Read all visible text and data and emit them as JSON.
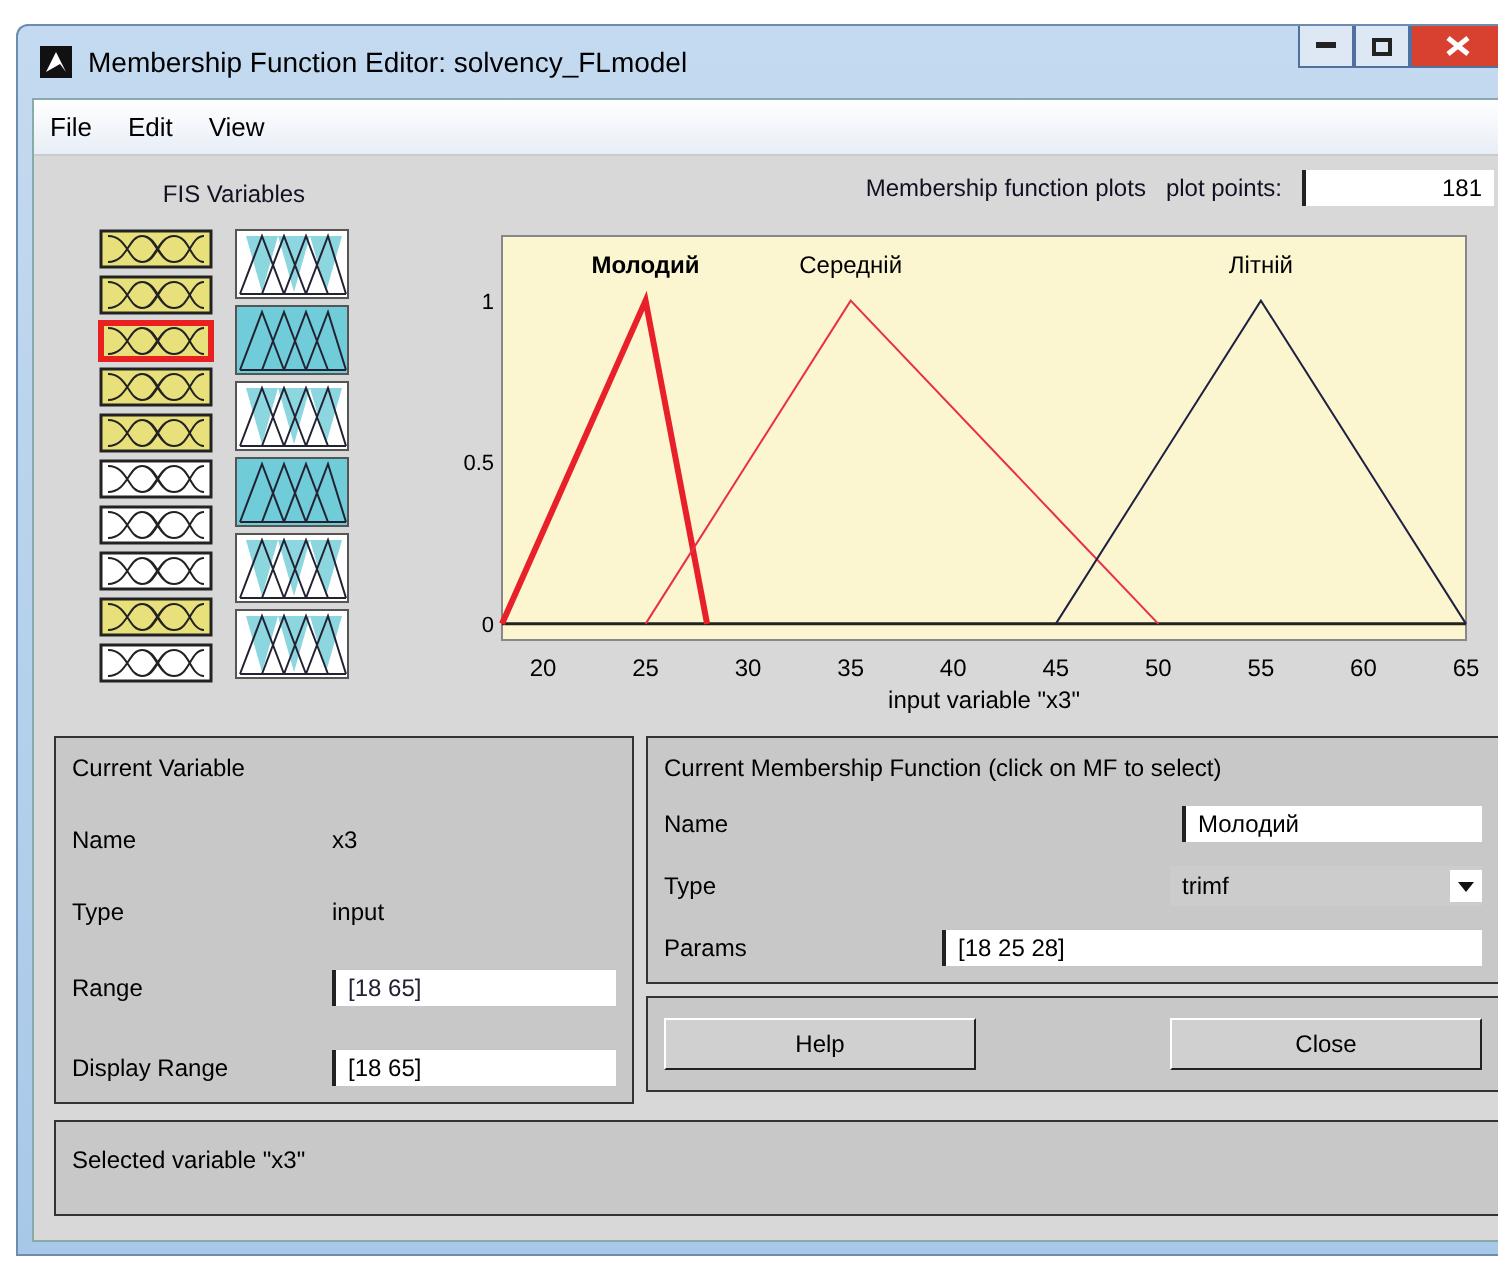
{
  "window": {
    "title": "Membership Function Editor: solvency_FLmodel"
  },
  "menu": [
    "File",
    "Edit",
    "View"
  ],
  "fis_variables": {
    "title": "FIS Variables",
    "inputs": [
      {
        "filled": true,
        "selected": false
      },
      {
        "filled": true,
        "selected": false
      },
      {
        "filled": true,
        "selected": true
      },
      {
        "filled": true,
        "selected": false
      },
      {
        "filled": true,
        "selected": false
      },
      {
        "filled": false,
        "selected": false
      },
      {
        "filled": false,
        "selected": false
      },
      {
        "filled": false,
        "selected": false
      },
      {
        "filled": true,
        "selected": false
      },
      {
        "filled": false,
        "selected": false
      }
    ],
    "outputs": [
      {
        "filled": false
      },
      {
        "filled": true
      },
      {
        "filled": false
      },
      {
        "filled": true
      },
      {
        "filled": false
      },
      {
        "filled": false
      }
    ]
  },
  "plot_header": {
    "title": "Membership function plots",
    "plot_points_label": "plot points:",
    "plot_points": "181"
  },
  "plot": {
    "chart_data": {
      "type": "line",
      "xlabel": "input variable \"x3\"",
      "x": [
        18,
        25,
        28,
        35,
        45,
        50,
        55,
        65
      ],
      "series": [
        {
          "name": "Молодий",
          "color": "#e8202a",
          "values": [
            0,
            1,
            0,
            null,
            null,
            null,
            null,
            null
          ]
        },
        {
          "name": "Середній",
          "color": "#e8304a",
          "values": [
            null,
            0,
            0.3,
            1,
            0.333,
            0,
            null,
            null
          ]
        },
        {
          "name": "Лiтнiй",
          "color": "#202040",
          "values": [
            null,
            null,
            null,
            null,
            0,
            0.5,
            1,
            0
          ]
        }
      ],
      "xlim": [
        18,
        65
      ],
      "ylim": [
        -0.05,
        1.2
      ],
      "xticks": [
        20,
        25,
        30,
        35,
        40,
        45,
        50,
        55,
        60,
        65
      ],
      "yticks": [
        0,
        {
          "value": 0.5,
          "label": "0.5"
        },
        1
      ]
    },
    "functions": [
      {
        "selected": true
      },
      {
        "selected": false
      },
      {
        "selected": false
      }
    ]
  },
  "current_variable": {
    "title": "Current Variable",
    "name_label": "Name",
    "name": "x3",
    "type_label": "Type",
    "type": "input",
    "range_label": "Range",
    "range": "[18 65]",
    "display_range_label": "Display Range",
    "display_range": "[18 65]"
  },
  "current_mf": {
    "title": "Current Membership Function (click on MF to select)",
    "name_label": "Name",
    "name": "Молодий",
    "type_label": "Type",
    "type": "trimf",
    "params_label": "Params",
    "params": "[18 25 28]"
  },
  "buttons": [
    "Help",
    "Close"
  ],
  "status": "Selected variable \"x3\""
}
